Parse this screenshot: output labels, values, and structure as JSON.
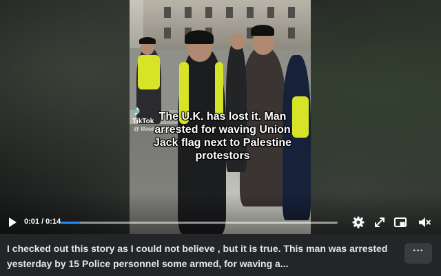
{
  "video": {
    "overlay_caption": "The U.K. has lost it. Man arrested for waving Union Jack flag next to Palestine protestors",
    "watermark": {
      "logo": "♪",
      "name": "TikTok",
      "handle": "@ lifewithkas101"
    }
  },
  "player": {
    "time": "0:01 / 0:14",
    "progress": 0.07,
    "icons": {
      "play": "play-icon",
      "settings": "gear-icon",
      "fullscreen": "expand-icon",
      "pip": "picture-in-picture-icon",
      "volume": "muted-volume-icon"
    }
  },
  "post": {
    "description": "I checked out this story as I could not believe , but it is true. This man was arrested yesterday by 15 Police personnel some armed, for waving a...",
    "more_label": "···"
  },
  "colors": {
    "accent": "#2d88ff",
    "background": "#242526",
    "text": "#e4e6eb"
  }
}
